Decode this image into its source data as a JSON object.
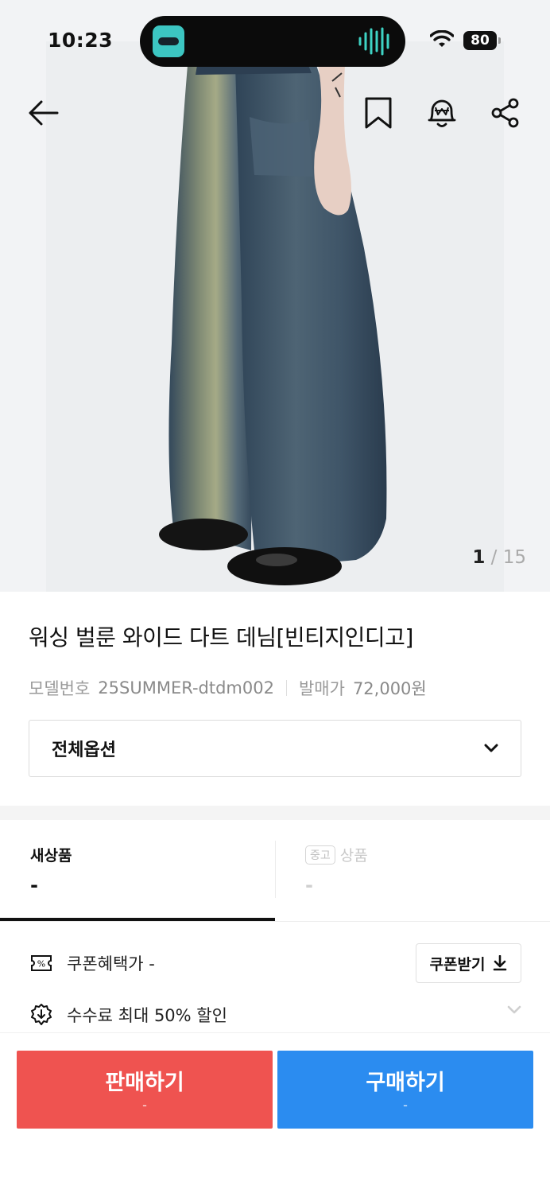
{
  "status_bar": {
    "time": "10:23",
    "battery": "80"
  },
  "gallery": {
    "current": "1",
    "separator": "/",
    "total": "15"
  },
  "product": {
    "title": "워싱 벌룬 와이드 다트 데님[빈티지인디고]",
    "model_label": "모델번호",
    "model_value": "25SUMMER-dtdm002",
    "release_label": "발매가",
    "release_value": "72,000원"
  },
  "options": {
    "selected": "전체옵션"
  },
  "tabs": [
    {
      "label": "새상품",
      "price": "-"
    },
    {
      "badge": "중고",
      "label": "상품",
      "price": "-"
    }
  ],
  "benefits": {
    "coupon_text": "쿠폰혜택가 -",
    "coupon_button": "쿠폰받기",
    "fee_text": "수수료 최대 50% 할인"
  },
  "actions": {
    "sell_label": "판매하기",
    "sell_price": "-",
    "buy_label": "구매하기",
    "buy_price": "-"
  },
  "colors": {
    "sell": "#ef5350",
    "buy": "#2b8cf0",
    "denim": "#3e5468",
    "wash": "#9aa284"
  },
  "icons": [
    "back-arrow-icon",
    "bookmark-icon",
    "price-alert-bell-icon",
    "share-icon",
    "chevron-down-icon",
    "coupon-icon",
    "discount-icon",
    "download-icon"
  ]
}
